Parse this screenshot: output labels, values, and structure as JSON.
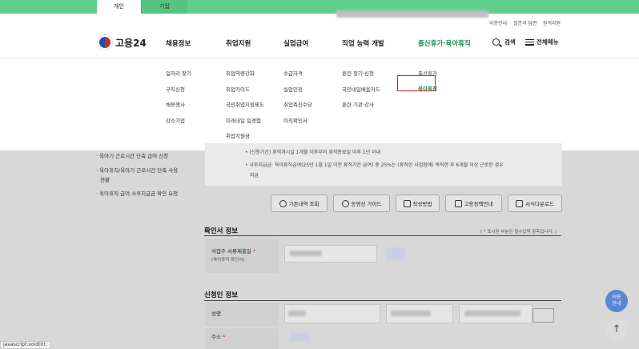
{
  "top_tabs": {
    "personal": "개인",
    "business": "기업"
  },
  "header_util": {
    "use_guide": "이용안내",
    "faq": "질문과 답변",
    "remote": "원격지원"
  },
  "logo": {
    "text": "고용24"
  },
  "gnb": [
    "채용정보",
    "취업지원",
    "실업급여",
    "직업 능력 개발",
    "출산휴가·육아휴직"
  ],
  "right_util": {
    "search": "검색",
    "all_menu": "전체메뉴"
  },
  "submenus": {
    "jobs": [
      "일자리 찾기",
      "구직신청",
      "채용행사",
      "강소기업"
    ],
    "employment_support": [
      "취업역량강화",
      "취업가이드",
      "국민취업지원제도",
      "미래내일 일경험",
      "취업지원금"
    ],
    "unemployment": [
      "수급자격",
      "실업인정",
      "취업촉진수당",
      "이직확인서"
    ],
    "vocational": [
      "훈련 찾기·신청",
      "국민내일배움카드",
      "훈련 기관·강사"
    ],
    "parental": [
      "출산휴가",
      "육아휴직"
    ]
  },
  "left_nav": [
    "· 육아기 근로시간 단축 급여 신청",
    "· 육아휴직/육아기 근로시간 단축 사용",
    "현황",
    "· 육아휴직 급여 사후지급금 확인 요청"
  ],
  "notice": {
    "line1": "• (신청기간) 휴직개시일 1개월 이후부터 휴직종료일 이후 1년 이내",
    "line2": "• 사후지급금: 육아휴직급여(25년 1월 1일 이전 휴직기간 급여) 중 25%는 (휴직한 사업장에) 복직한 후 6개월 이상 근로한 경우",
    "line3": "지급"
  },
  "buttons": [
    "기존내역 조회",
    "동영상 가이드",
    "작성방법",
    "고용정책안내",
    "서식다운로드"
  ],
  "confirm_section": {
    "title": "확인서 정보",
    "required_note_star": "*",
    "required_note": "표시된 부분은 필수입력 항목입니다.",
    "field_label": "사업주 서류제출일",
    "field_sub": "(육아휴직 확인서)"
  },
  "applicant_section": {
    "title": "신청인 정보",
    "name_label": "성명",
    "address_label": "주소"
  },
  "float_button": {
    "line1": "이용",
    "line2": "안내"
  },
  "top_button": "↑",
  "status_bar": "javascript:void(0);",
  "colors": {
    "brand_green": "#5fce8a",
    "active_green": "#1e8f4c",
    "highlight_red": "#d81e26",
    "guide_blue": "#5a86d6"
  }
}
